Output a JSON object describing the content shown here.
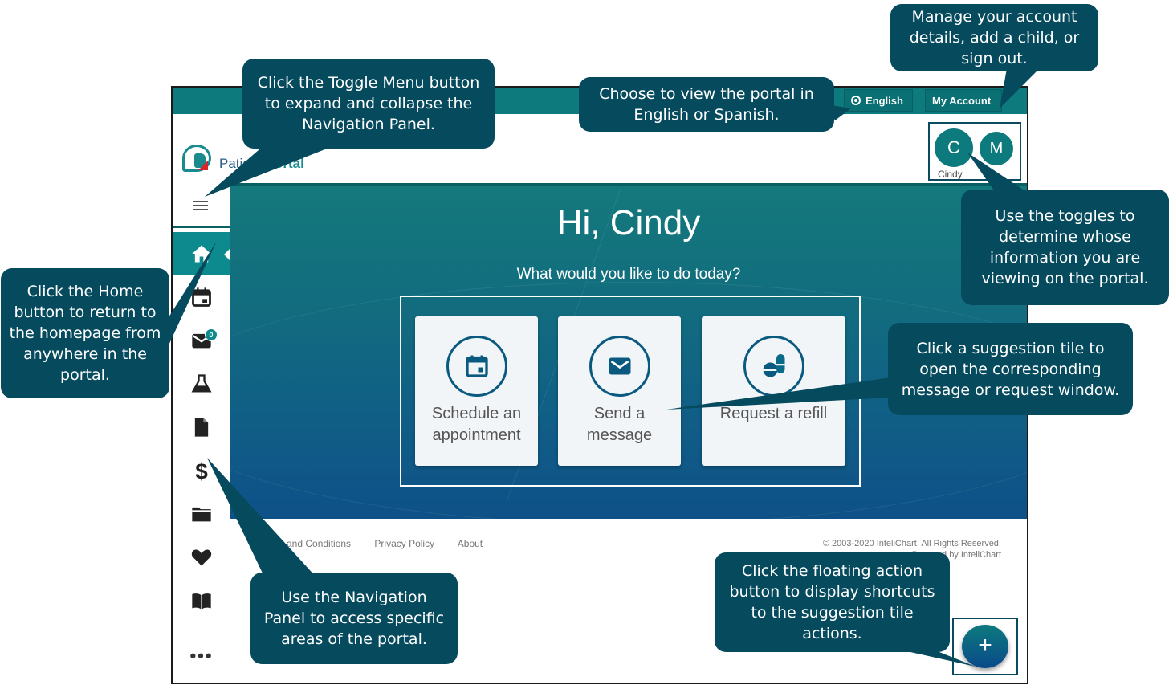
{
  "topbar": {
    "language_label": "English",
    "account_label": "My Account"
  },
  "header": {
    "logo_text_a": "Patient",
    "logo_text_b": "Portal",
    "profiles": [
      {
        "initial": "C",
        "name": "Cindy"
      },
      {
        "initial": "M"
      }
    ]
  },
  "sidebar": {
    "items": [
      {
        "id": "home",
        "icon": "home-icon",
        "active": true
      },
      {
        "id": "appointments",
        "icon": "calendar-icon"
      },
      {
        "id": "messages",
        "icon": "envelope-icon",
        "badge": "0"
      },
      {
        "id": "lab-results",
        "icon": "flask-icon"
      },
      {
        "id": "documents",
        "icon": "file-icon"
      },
      {
        "id": "billing",
        "icon": "dollar-icon"
      },
      {
        "id": "records",
        "icon": "folder-icon"
      },
      {
        "id": "health",
        "icon": "heart-icon"
      },
      {
        "id": "education",
        "icon": "book-icon"
      }
    ],
    "more_label": "•••"
  },
  "hero": {
    "greeting": "Hi, Cindy",
    "subtitle": "What would you like to do today?",
    "tiles": [
      {
        "label": "Schedule an appointment",
        "icon": "calendar-icon"
      },
      {
        "label": "Send a message",
        "icon": "envelope-icon"
      },
      {
        "label": "Request a refill",
        "icon": "pills-icon"
      }
    ]
  },
  "footer": {
    "links": [
      "Terms and Conditions",
      "Privacy Policy",
      "About"
    ],
    "copyright": "© 2003-2020 InteliChart. All Rights Reserved.",
    "powered_by": "Powered by InteliChart"
  },
  "fab": {
    "label": "+"
  },
  "callouts": {
    "toggle_menu": "Click the Toggle Menu button to expand and collapse the Navigation Panel.",
    "language": "Choose to view the portal in English or Spanish.",
    "account": "Manage your account details, add a child, or sign out.",
    "home": "Click the Home button to return to the homepage from anywhere in the portal.",
    "profiles": "Use the toggles to determine whose information you are viewing on the portal.",
    "tiles": "Click a suggestion tile to open the corresponding message or request window.",
    "nav_panel": "Use the Navigation Panel to access specific areas of the portal.",
    "fab": "Click the floating action button to display shortcuts to the suggestion tile actions."
  }
}
